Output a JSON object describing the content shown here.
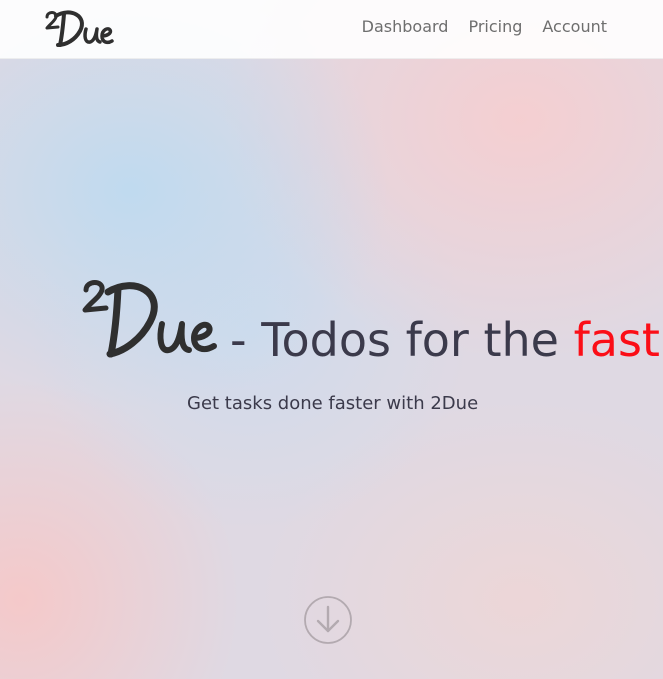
{
  "nav": {
    "brand": "2Due",
    "links": [
      "Dashboard",
      "Pricing",
      "Account"
    ]
  },
  "hero": {
    "logo": "2Due",
    "title_prefix": "- Todos for the",
    "title_accent": "fast",
    "tagline": "Get tasks done faster with 2Due",
    "scroll_icon": "arrow-down-circle"
  },
  "colors": {
    "accent": "#fb0e17",
    "text": "#3b3a4b",
    "nav_link": "#6e6e6e"
  }
}
